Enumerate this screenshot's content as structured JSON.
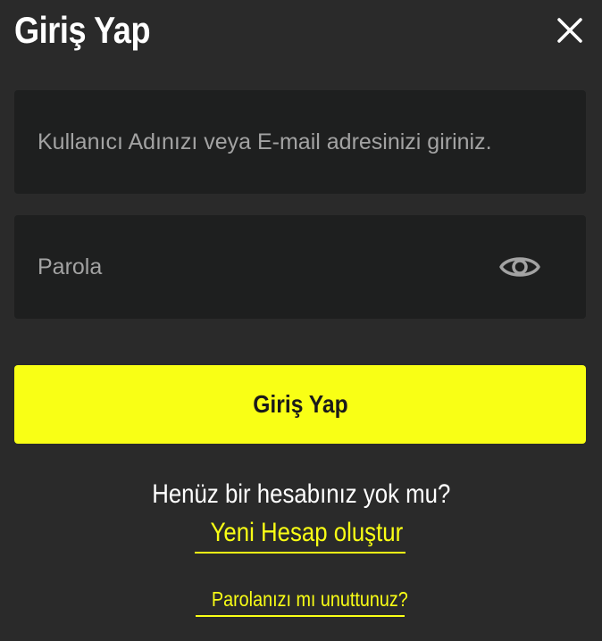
{
  "modal": {
    "title": "Giriş Yap",
    "close_icon": "close-icon"
  },
  "form": {
    "username_placeholder": "Kullanıcı Adınızı veya E-mail adresinizi giriniz.",
    "username_value": "",
    "password_placeholder": "Parola",
    "password_value": "",
    "password_toggle_icon": "eye-icon",
    "submit_label": "Giriş Yap"
  },
  "footer": {
    "no_account_text": "Henüz bir hesabınız yok mu?",
    "register_label": "Yeni Hesap oluştur",
    "forgot_password_label": "Parolanızı mı unuttunuz?"
  },
  "colors": {
    "background": "#2a2a2a",
    "input_background": "#1e1f1f",
    "accent": "#f9ff15",
    "text": "#ffffff",
    "placeholder": "#a3a3a3"
  }
}
